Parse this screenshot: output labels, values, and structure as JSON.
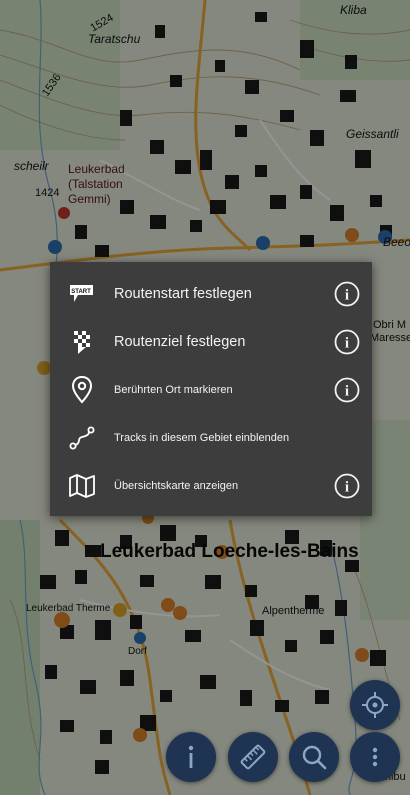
{
  "map": {
    "labels": {
      "kliba": "Kliba",
      "taratschu": "Taratschu",
      "n1524": "1524",
      "n1536": "1536",
      "geissantli": "Geissantli",
      "scheilr": "scheilr",
      "leukerbad_red": "Leukerbad",
      "talstation": "(Talstation",
      "gemmi": "Gemmi)",
      "n1424": "1424",
      "beeo": "Beeo",
      "obri": "Obri M",
      "maresse": "Maresse",
      "town": "Leukerbad Loeche-les-Bains",
      "leukerbad_therme": "Leukerbad Therme",
      "alpentherme": "Alpentherme",
      "dorf": "Dorf",
      "schibu": "Schibu"
    }
  },
  "menu": {
    "items": [
      {
        "label": "Routenstart festlegen",
        "icon": "start-flag-icon",
        "info": true
      },
      {
        "label": "Routenziel festlegen",
        "icon": "finish-flag-icon",
        "info": true
      },
      {
        "label": "Berührten Ort markieren",
        "icon": "map-pin-icon",
        "info": true
      },
      {
        "label": "Tracks in diesem Gebiet einblenden",
        "icon": "track-icon",
        "info": false
      },
      {
        "label": "Übersichtskarte anzeigen",
        "icon": "map-icon",
        "info": true
      }
    ],
    "start_badge": "START",
    "info_glyph": "i"
  },
  "colors": {
    "menu_bg": "#3d3d3d",
    "fab_bg": "#1e3452",
    "text": "#f2f2f2"
  }
}
